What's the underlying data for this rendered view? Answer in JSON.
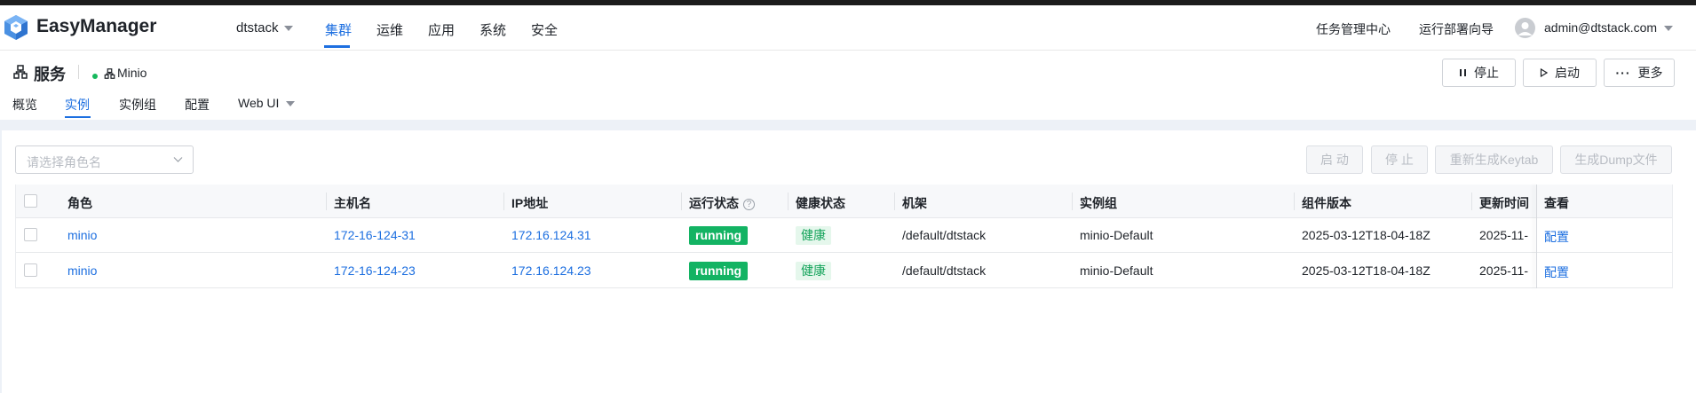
{
  "header": {
    "brand": "EasyManager",
    "tenant": "dtstack",
    "nav": [
      "集群",
      "运维",
      "应用",
      "系统",
      "安全"
    ],
    "active_nav": "集群",
    "links": [
      "任务管理中心",
      "运行部署向导"
    ],
    "user": "admin@dtstack.com"
  },
  "page": {
    "title": "服务",
    "service_name": "Minio",
    "actions": {
      "stop": "停止",
      "start": "启动",
      "more": "更多"
    },
    "tabs": [
      "概览",
      "实例",
      "实例组",
      "配置",
      "Web UI"
    ],
    "active_tab": "实例"
  },
  "toolbar": {
    "role_placeholder": "请选择角色名",
    "start": "启 动",
    "stop": "停 止",
    "regen_keytab": "重新生成Keytab",
    "gen_dump": "生成Dump文件"
  },
  "table": {
    "columns": [
      "角色",
      "主机名",
      "IP地址",
      "运行状态",
      "健康状态",
      "机架",
      "实例组",
      "组件版本",
      "更新时间",
      "查看"
    ],
    "rows": [
      {
        "role": "minio",
        "host": "172-16-124-31",
        "ip": "172.16.124.31",
        "status": "running",
        "health": "健康",
        "rack": "/default/dtstack",
        "group": "minio-Default",
        "version": "2025-03-12T18-04-18Z",
        "updated": "2025-11-",
        "view": "配置"
      },
      {
        "role": "minio",
        "host": "172-16-124-23",
        "ip": "172.16.124.23",
        "status": "running",
        "health": "健康",
        "rack": "/default/dtstack",
        "group": "minio-Default",
        "version": "2025-03-12T18-04-18Z",
        "updated": "2025-11-",
        "view": "配置"
      }
    ]
  },
  "colors": {
    "accent": "#1d6fe0",
    "running": "#13b363",
    "healthy_bg": "#e5f7ec",
    "healthy_text": "#13a35a",
    "content_bg": "#edf1f7"
  }
}
